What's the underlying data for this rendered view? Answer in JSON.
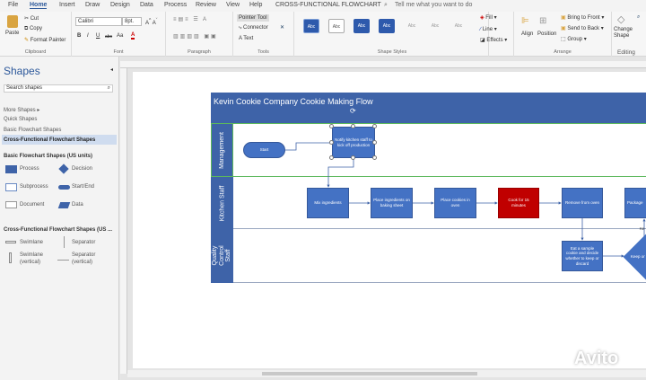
{
  "menu": {
    "tabs": [
      "File",
      "Home",
      "Insert",
      "Draw",
      "Design",
      "Data",
      "Process",
      "Review",
      "View",
      "Help"
    ],
    "doc_title": "CROSS-FUNCTIONAL FLOWCHART",
    "tell_me": "Tell me what you want to do"
  },
  "ribbon": {
    "clipboard": {
      "paste": "Paste",
      "cut": "Cut",
      "copy": "Copy",
      "format_painter": "Format Painter",
      "label": "Clipboard"
    },
    "font": {
      "name": "Calibri",
      "size": "8pt.",
      "label": "Font",
      "bold": "B",
      "italic": "I",
      "underline": "U",
      "strike": "abc",
      "case": "Aa"
    },
    "paragraph": {
      "label": "Paragraph"
    },
    "tools": {
      "pointer": "Pointer Tool",
      "connector": "Connector",
      "text": "Text",
      "label": "Tools"
    },
    "shape_styles": {
      "abc": "Abc",
      "fill": "Fill",
      "line": "Line",
      "effects": "Effects",
      "label": "Shape Styles"
    },
    "arrange": {
      "align": "Align",
      "position": "Position",
      "bring_front": "Bring to Front",
      "send_back": "Send to Back",
      "group": "Group",
      "label": "Arrange"
    },
    "editing": {
      "change_shape": "Change Shape",
      "label": "Editing"
    }
  },
  "shapes_pane": {
    "title": "Shapes",
    "search_placeholder": "Search shapes",
    "links": [
      "More Shapes",
      "Quick Shapes",
      "Basic Flowchart Shapes",
      "Cross-Functional Flowchart Shapes"
    ],
    "basic_title": "Basic Flowchart Shapes (US units)",
    "basic": [
      "Process",
      "Decision",
      "Subprocess",
      "Start/End",
      "Document",
      "Data"
    ],
    "cf_title": "Cross-Functional Flowchart Shapes (US ...",
    "cf": [
      "Swimlane",
      "Separator",
      "Swimlane (vertical)",
      "Separator (vertical)"
    ]
  },
  "diagram": {
    "title": "Kevin Cookie Company Cookie Making Flow",
    "lanes": [
      "Management",
      "Kitchen Staff",
      "Quality Control Staff"
    ],
    "nodes": {
      "start": "Start",
      "notify": "Notify kitchen staff to kick off production",
      "mix": "Mix ingredients",
      "place_ing": "Place ingredients on baking sheet",
      "place_oven": "Place cookies in oven",
      "cook": "Cook for 15 minutes",
      "remove": "Remove from oven",
      "package": "Package",
      "eat": "Eat a sample cookie and decide whether to keep or discard",
      "keep": "Keep or",
      "keep_label": "Ke"
    },
    "colors": {
      "shape": "#4472c4",
      "highlight": "#c00000",
      "title": "#3e63a8"
    }
  },
  "watermark": "Avito"
}
